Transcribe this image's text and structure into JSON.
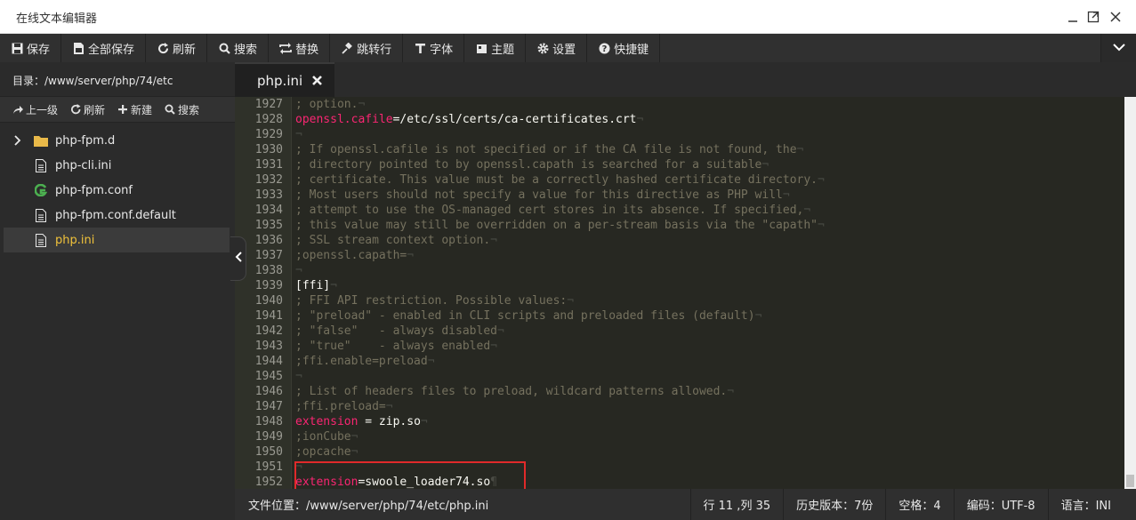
{
  "window": {
    "title": "在线文本编辑器"
  },
  "toolbar": [
    {
      "label": "保存",
      "icon": "save-icon"
    },
    {
      "label": "全部保存",
      "icon": "save-all-icon"
    },
    {
      "label": "刷新",
      "icon": "refresh-icon"
    },
    {
      "label": "搜索",
      "icon": "search-icon"
    },
    {
      "label": "替换",
      "icon": "replace-icon"
    },
    {
      "label": "跳转行",
      "icon": "pin-icon"
    },
    {
      "label": "字体",
      "icon": "font-icon"
    },
    {
      "label": "主题",
      "icon": "theme-icon"
    },
    {
      "label": "设置",
      "icon": "gear-icon"
    },
    {
      "label": "快捷键",
      "icon": "help-icon"
    }
  ],
  "sidebar": {
    "path": "目录：/www/server/php/74/etc",
    "tools": [
      "上一级",
      "刷新",
      "新建",
      "搜索"
    ],
    "items": [
      {
        "label": "php-fpm.d",
        "type": "folder"
      },
      {
        "label": "php-cli.ini",
        "type": "file"
      },
      {
        "label": "php-fpm.conf",
        "type": "file-green"
      },
      {
        "label": "php-fpm.conf.default",
        "type": "file"
      },
      {
        "label": "php.ini",
        "type": "file",
        "active": true
      }
    ]
  },
  "tab": {
    "label": "php.ini"
  },
  "code": [
    {
      "n": "1927",
      "parts": [
        [
          "c",
          "; option."
        ],
        [
          "i",
          "¬"
        ]
      ]
    },
    {
      "n": "1928",
      "parts": [
        [
          "k",
          "openssl.cafile"
        ],
        [
          "v",
          "=/etc/ssl/certs/ca-certificates.crt"
        ],
        [
          "i",
          "¬"
        ]
      ]
    },
    {
      "n": "1929",
      "parts": [
        [
          "i",
          "¬"
        ]
      ]
    },
    {
      "n": "1930",
      "parts": [
        [
          "c",
          "; If openssl.cafile is not specified or if the CA file is not found, the"
        ],
        [
          "i",
          "¬"
        ]
      ]
    },
    {
      "n": "1931",
      "parts": [
        [
          "c",
          "; directory pointed to by openssl.capath is searched for a suitable"
        ],
        [
          "i",
          "¬"
        ]
      ]
    },
    {
      "n": "1932",
      "parts": [
        [
          "c",
          "; certificate. This value must be a correctly hashed certificate directory."
        ],
        [
          "i",
          "¬"
        ]
      ]
    },
    {
      "n": "1933",
      "parts": [
        [
          "c",
          "; Most users should not specify a value for this directive as PHP will"
        ],
        [
          "i",
          "¬"
        ]
      ]
    },
    {
      "n": "1934",
      "parts": [
        [
          "c",
          "; attempt to use the OS-managed cert stores in its absence. If specified,"
        ],
        [
          "i",
          "¬"
        ]
      ]
    },
    {
      "n": "1935",
      "parts": [
        [
          "c",
          "; this value may still be overridden on a per-stream basis via the \"capath\""
        ],
        [
          "i",
          "¬"
        ]
      ]
    },
    {
      "n": "1936",
      "parts": [
        [
          "c",
          "; SSL stream context option."
        ],
        [
          "i",
          "¬"
        ]
      ]
    },
    {
      "n": "1937",
      "parts": [
        [
          "c",
          ";openssl.capath="
        ],
        [
          "i",
          "¬"
        ]
      ]
    },
    {
      "n": "1938",
      "parts": [
        [
          "i",
          "¬"
        ]
      ]
    },
    {
      "n": "1939",
      "parts": [
        [
          "v",
          "[ffi]"
        ],
        [
          "i",
          "¬"
        ]
      ]
    },
    {
      "n": "1940",
      "parts": [
        [
          "c",
          "; FFI API restriction. Possible values:"
        ],
        [
          "i",
          "¬"
        ]
      ]
    },
    {
      "n": "1941",
      "parts": [
        [
          "c",
          "; \"preload\" - enabled in CLI scripts and preloaded files (default)"
        ],
        [
          "i",
          "¬"
        ]
      ]
    },
    {
      "n": "1942",
      "parts": [
        [
          "c",
          "; \"false\"   - always disabled"
        ],
        [
          "i",
          "¬"
        ]
      ]
    },
    {
      "n": "1943",
      "parts": [
        [
          "c",
          "; \"true\"    - always enabled"
        ],
        [
          "i",
          "¬"
        ]
      ]
    },
    {
      "n": "1944",
      "parts": [
        [
          "c",
          ";ffi.enable=preload"
        ],
        [
          "i",
          "¬"
        ]
      ]
    },
    {
      "n": "1945",
      "parts": [
        [
          "i",
          "¬"
        ]
      ]
    },
    {
      "n": "1946",
      "parts": [
        [
          "c",
          "; List of headers files to preload, wildcard patterns allowed."
        ],
        [
          "i",
          "¬"
        ]
      ]
    },
    {
      "n": "1947",
      "parts": [
        [
          "c",
          ";ffi.preload="
        ],
        [
          "i",
          "¬"
        ]
      ]
    },
    {
      "n": "1948",
      "parts": [
        [
          "k",
          "extension"
        ],
        [
          "v",
          " = zip.so"
        ],
        [
          "i",
          "¬"
        ]
      ]
    },
    {
      "n": "1949",
      "parts": [
        [
          "c",
          ";ionCube"
        ],
        [
          "i",
          "¬"
        ]
      ]
    },
    {
      "n": "1950",
      "parts": [
        [
          "c",
          ";opcache"
        ],
        [
          "i",
          "¬"
        ]
      ]
    },
    {
      "n": "1951",
      "parts": [
        [
          "i",
          "¬"
        ]
      ]
    },
    {
      "n": "1952",
      "parts": [
        [
          "k",
          "extension"
        ],
        [
          "v",
          "=swoole_loader74.so"
        ],
        [
          "i",
          "¶"
        ]
      ]
    }
  ],
  "status": {
    "file_location": "文件位置：/www/server/php/74/etc/php.ini",
    "cursor": "行 11 ,列 35",
    "history": "历史版本：7份",
    "indent": "空格：4",
    "encoding": "编码：UTF-8",
    "language": "语言：INI"
  },
  "colors": {
    "background": "#272822",
    "comment": "#75715e",
    "keyword": "#f92672",
    "text": "#f8f8f2",
    "active_file": "#f0c23b",
    "highlight_border": "#e02a2a"
  }
}
